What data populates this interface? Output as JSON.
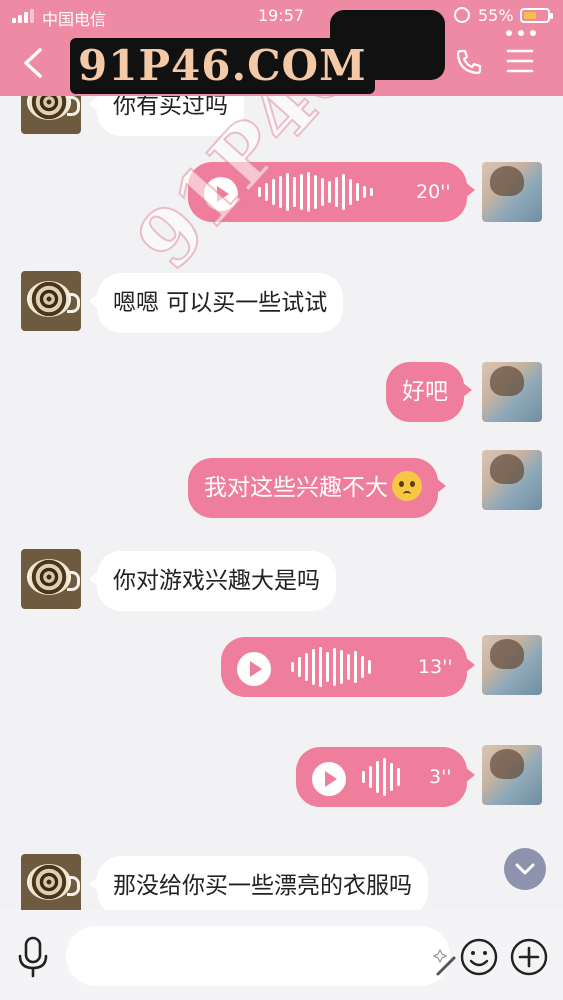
{
  "status_bar": {
    "carrier": "中国电信",
    "time": "19:57",
    "battery": "55%",
    "battery_level": 0.55
  },
  "header": {
    "title": "91P46.COM",
    "back_icon": "chevron-left-icon",
    "more_icon": "more-dots-icon",
    "phone_icon": "phone-icon",
    "menu_icon": "hamburger-menu-icon",
    "background": "#ee8aa4"
  },
  "watermark": "91P46.COM",
  "messages": [
    {
      "side": "in",
      "type": "text",
      "text": "你有买过吗"
    },
    {
      "side": "out",
      "type": "voice",
      "duration": "20''"
    },
    {
      "side": "in",
      "type": "text",
      "text": "嗯嗯  可以买一些试试"
    },
    {
      "side": "out",
      "type": "text",
      "text": "好吧"
    },
    {
      "side": "out",
      "type": "text",
      "text": "我对这些兴趣不大",
      "emoji": "pleading-face-emoji"
    },
    {
      "side": "in",
      "type": "text",
      "text": "你对游戏兴趣大是吗"
    },
    {
      "side": "out",
      "type": "voice",
      "duration": "13''"
    },
    {
      "side": "out",
      "type": "voice",
      "duration": "3''"
    },
    {
      "side": "in",
      "type": "text",
      "text": "那没给你买一些漂亮的衣服吗"
    }
  ],
  "colors": {
    "outgoing_bubble": "#ef7e9c",
    "incoming_bubble": "#ffffff",
    "chat_background": "#f2f2f4",
    "scroll_button": "#8e93ad"
  },
  "input_bar": {
    "placeholder": "",
    "mic_icon": "microphone-icon",
    "emoji_icon": "smiley-icon",
    "plus_icon": "plus-icon"
  }
}
